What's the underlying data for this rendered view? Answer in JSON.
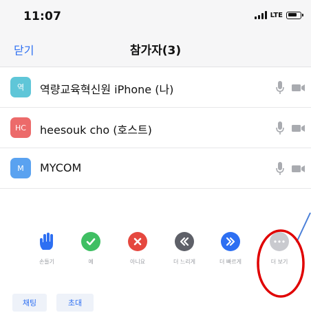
{
  "status_bar": {
    "time": "11:07",
    "network": "LTE"
  },
  "nav": {
    "close_label": "닫기",
    "title": "참가자(3)"
  },
  "participants": [
    {
      "avatar_text": "역",
      "avatar_color": "#5fc6d8",
      "name": "역량교육혁신원 iPhone (나)"
    },
    {
      "avatar_text": "HC",
      "avatar_color": "#ec6a6a",
      "name": "heesouk cho (호스트)"
    },
    {
      "avatar_text": "M",
      "avatar_color": "#5aa2f0",
      "name": "MYCOM"
    }
  ],
  "reactions": [
    {
      "label": "손들기",
      "icon": "raise-hand-icon",
      "color": "#2d6ff2"
    },
    {
      "label": "예",
      "icon": "check-icon",
      "color": "#3fbf63"
    },
    {
      "label": "아니요",
      "icon": "x-icon",
      "color": "#e5483f"
    },
    {
      "label": "더 느리게",
      "icon": "slower-icon",
      "color": "#5e6068"
    },
    {
      "label": "더 빠르게",
      "icon": "faster-icon",
      "color": "#2d6ff2"
    },
    {
      "label": "더 보기",
      "icon": "more-icon",
      "color": "#c9cacf"
    }
  ],
  "bottom": {
    "chat_label": "채팅",
    "invite_label": "초대"
  },
  "colors": {
    "accent": "#2d6ff2",
    "annotation_red": "#e00000",
    "annotation_line": "#4a7fd8"
  }
}
